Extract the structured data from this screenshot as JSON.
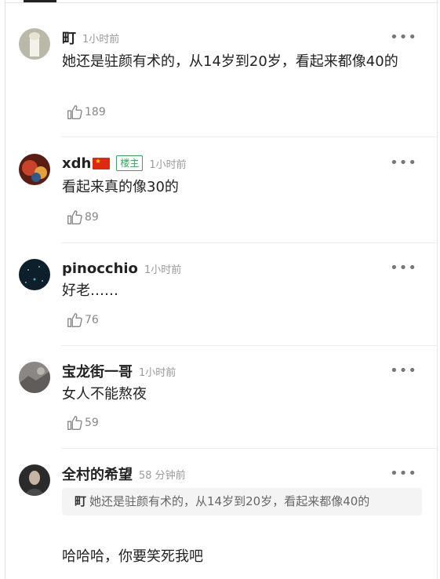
{
  "comments": [
    {
      "name": "町",
      "time": "1小时前",
      "text": "她还是驻颜有术的，从14岁到20岁，看起来都像40的",
      "likes": "189",
      "more": "•••"
    },
    {
      "name": "xdh",
      "badge": "楼主",
      "time": "1小时前",
      "text": "看起来真的像30的",
      "likes": "89",
      "more": "•••"
    },
    {
      "name": "pinocchio",
      "time": "1小时前",
      "text": "好老……",
      "likes": "76",
      "more": "•••"
    },
    {
      "name": "宝龙街一哥",
      "time": "1小时前",
      "text": "女人不能熬夜",
      "likes": "59",
      "more": "•••"
    },
    {
      "name": "全村的希望",
      "time": "58 分钟前",
      "quote": {
        "name": "町",
        "text": "她还是驻颜有术的，从14岁到20岁，看起来都像40的"
      },
      "text": "哈哈哈，你要笑死我吧",
      "more": "•••"
    }
  ],
  "icons": {
    "like": "thumbs-up-icon",
    "more": "more-dots-icon",
    "flag": "china-flag-icon"
  },
  "colors": {
    "owner_badge": "#37a35b",
    "meta_gray": "#9a9a9a"
  }
}
